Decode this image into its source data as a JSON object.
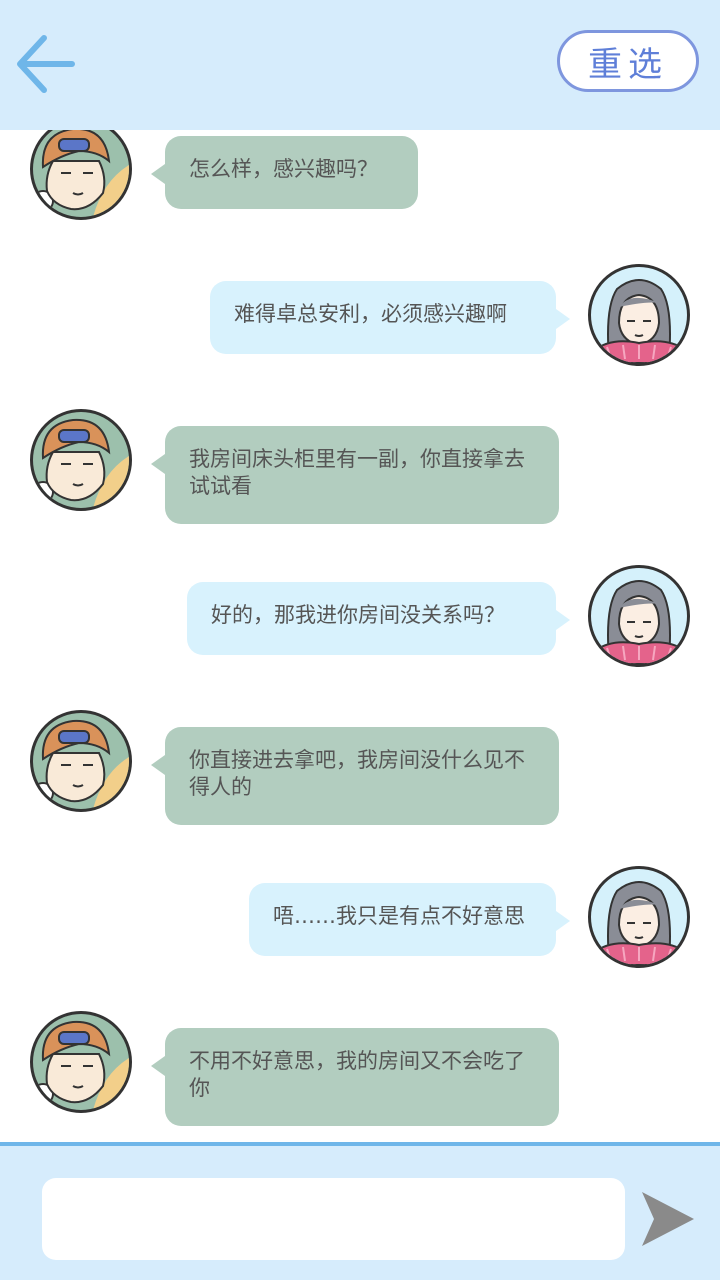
{
  "header": {
    "back_icon": "arrow-left-icon",
    "reselect_label": "重选",
    "accent_color": "#7e96de"
  },
  "messages": [
    {
      "sender": "boy",
      "text": "怎么样，感兴趣吗？"
    },
    {
      "sender": "girl",
      "text": "难得卓总安利，必须感兴趣啊"
    },
    {
      "sender": "boy",
      "text": "我房间床头柜里有一副，你直接拿去试试看"
    },
    {
      "sender": "girl",
      "text": "好的，那我进你房间没关系吗？"
    },
    {
      "sender": "boy",
      "text": "你直接进去拿吧，我房间没什么见不得人的"
    },
    {
      "sender": "girl",
      "text": "唔……我只是有点不好意思"
    },
    {
      "sender": "boy",
      "text": "不用不好意思，我的房间又不会吃了你"
    }
  ],
  "composer": {
    "input_value": "",
    "input_placeholder": "",
    "send_icon": "send-icon"
  },
  "colors": {
    "header_bg": "#d6ecfc",
    "left_bubble": "#b2cdbf",
    "right_bubble": "#d8f2fd",
    "divider": "#6fb6e9"
  }
}
